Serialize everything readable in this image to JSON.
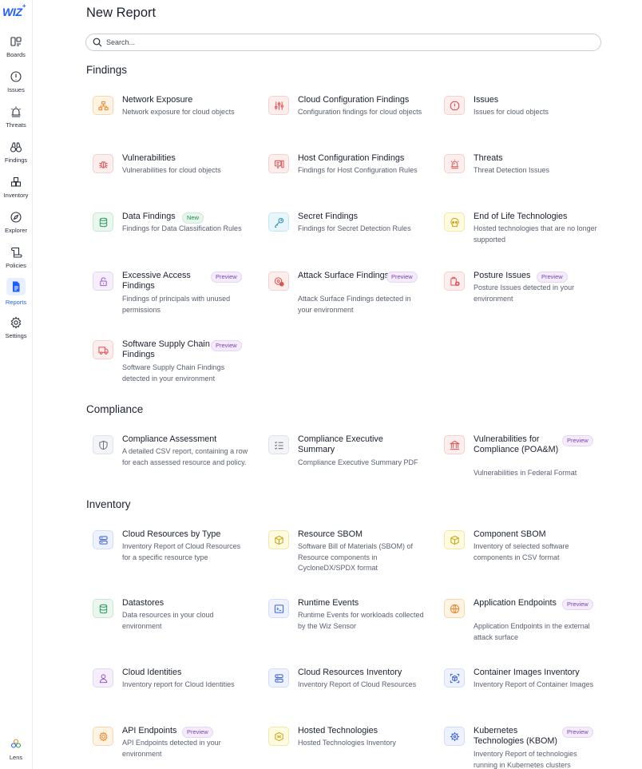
{
  "app": {
    "logo": "WIZ",
    "logo_mark": "+"
  },
  "sidebar": {
    "items": [
      {
        "label": "Boards",
        "icon": "boards-icon"
      },
      {
        "label": "Issues",
        "icon": "issues-icon"
      },
      {
        "label": "Threats",
        "icon": "threats-icon"
      },
      {
        "label": "Findings",
        "icon": "findings-icon"
      },
      {
        "label": "Inventory",
        "icon": "inventory-icon"
      },
      {
        "label": "Explorer",
        "icon": "explorer-icon"
      },
      {
        "label": "Policies",
        "icon": "policies-icon"
      },
      {
        "label": "Reports",
        "icon": "reports-icon",
        "active": true
      },
      {
        "label": "Settings",
        "icon": "settings-icon"
      }
    ],
    "bottom": {
      "label": "Lens",
      "icon": "lens-icon"
    }
  },
  "page": {
    "title": "New Report",
    "search_placeholder": "Search..."
  },
  "sections": {
    "findings": {
      "title": "Findings",
      "cards": [
        {
          "title": "Network Exposure",
          "desc": "Network exposure for cloud objects",
          "icon": "network-icon",
          "color": "#e8892b"
        },
        {
          "title": "Cloud Configuration Findings",
          "desc": "Configuration findings for cloud objects",
          "icon": "sliders-icon",
          "color": "#e05252"
        },
        {
          "title": "Issues",
          "desc": "Issues for cloud objects",
          "icon": "alert-circle-icon",
          "color": "#e05252"
        },
        {
          "title": "Vulnerabilities",
          "desc": "Vulnerabilities for cloud objects",
          "icon": "bug-icon",
          "color": "#e05252"
        },
        {
          "title": "Host Configuration Findings",
          "desc": "Findings for Host Configuration Rules",
          "icon": "host-config-icon",
          "color": "#e05252"
        },
        {
          "title": "Threats",
          "desc": "Threat Detection Issues",
          "icon": "siren-icon",
          "color": "#e05252"
        },
        {
          "title": "Data Findings",
          "desc": "Findings for Data Classification Rules",
          "icon": "database-icon",
          "color": "#2e9c5a",
          "badge": "New"
        },
        {
          "title": "Secret Findings",
          "desc": "Findings for Secret Detection Rules",
          "icon": "key-icon",
          "color": "#2b8fb8"
        },
        {
          "title": "End of Life Technologies",
          "desc": "Hosted technologies that are no longer supported",
          "icon": "skull-icon",
          "color": "#c9a30e"
        },
        {
          "title": "Excessive Access Findings",
          "desc": "Findings of principals with unused permissions",
          "icon": "unlock-icon",
          "color": "#9a5bd1",
          "badge": "Preview"
        },
        {
          "title": "Attack Surface Findings",
          "desc": "Attack Surface Findings detected in your environment",
          "icon": "target-icon",
          "color": "#e05252",
          "badge": "Preview"
        },
        {
          "title": "Posture Issues",
          "desc": "Posture Issues detected in your environment",
          "icon": "posture-icon",
          "color": "#e05252",
          "badge": "Preview"
        },
        {
          "title": "Software Supply Chain Findings",
          "desc": "Software Supply Chain Findings detected in your environment",
          "icon": "truck-icon",
          "color": "#e05252",
          "badge": "Preview"
        }
      ]
    },
    "compliance": {
      "title": "Compliance",
      "cards": [
        {
          "title": "Compliance Assessment",
          "desc": "A detailed CSV report, containing a row for each assessed resource and policy.",
          "icon": "shield-icon",
          "color": "#6b7080"
        },
        {
          "title": "Compliance Executive Summary",
          "desc": "Compliance Executive Summary PDF",
          "icon": "checklist-icon",
          "color": "#6b7080"
        },
        {
          "title": "Vulnerabilities for Compliance (POA&M)",
          "desc": "Vulnerabilities in Federal Format",
          "icon": "bank-icon",
          "color": "#e05252",
          "badge": "Preview"
        }
      ]
    },
    "inventory": {
      "title": "Inventory",
      "cards": [
        {
          "title": "Cloud Resources by Type",
          "desc": "Inventory Report of Cloud Resources for a specific resource type",
          "icon": "server-icon",
          "color": "#3b63d9"
        },
        {
          "title": "Resource SBOM",
          "desc": "Software Bill of Materials (SBOM) of Resource components in CycloneDX/SPDX format",
          "icon": "package-icon",
          "color": "#c9a30e"
        },
        {
          "title": "Component SBOM",
          "desc": "Inventory of selected software components in CSV format",
          "icon": "package-icon",
          "color": "#c9a30e"
        },
        {
          "title": "Datastores",
          "desc": "Data resources in your cloud environment",
          "icon": "database-icon",
          "color": "#2e9c5a"
        },
        {
          "title": "Runtime Events",
          "desc": "Runtime Events for workloads collected by the Wiz Sensor",
          "icon": "terminal-icon",
          "color": "#3b63d9"
        },
        {
          "title": "Application Endpoints",
          "desc": "Application Endpoints in the external attack surface",
          "icon": "globe-icon",
          "color": "#e8892b",
          "badge": "Preview"
        },
        {
          "title": "Cloud Identities",
          "desc": "Inventory report for Cloud Identities",
          "icon": "user-icon",
          "color": "#9a5bd1"
        },
        {
          "title": "Cloud Resources Inventory",
          "desc": "Inventory Report of Cloud Resources",
          "icon": "server-icon",
          "color": "#3b63d9"
        },
        {
          "title": "Container Images Inventory",
          "desc": "Inventory Report of Container Images",
          "icon": "container-icon",
          "color": "#3b63d9"
        },
        {
          "title": "API Endpoints",
          "desc": "API Endpoints detected in your environment",
          "icon": "gear-api-icon",
          "color": "#e8892b",
          "badge": "Preview"
        },
        {
          "title": "Hosted Technologies",
          "desc": "Hosted Technologies Inventory",
          "icon": "tech-icon",
          "color": "#c9a30e"
        },
        {
          "title": "Kubernetes Technologies (KBOM)",
          "desc": "Inventory Report of technologies running in Kubernetes clusters",
          "icon": "helm-icon",
          "color": "#3b63d9",
          "badge": "Preview"
        }
      ]
    }
  }
}
